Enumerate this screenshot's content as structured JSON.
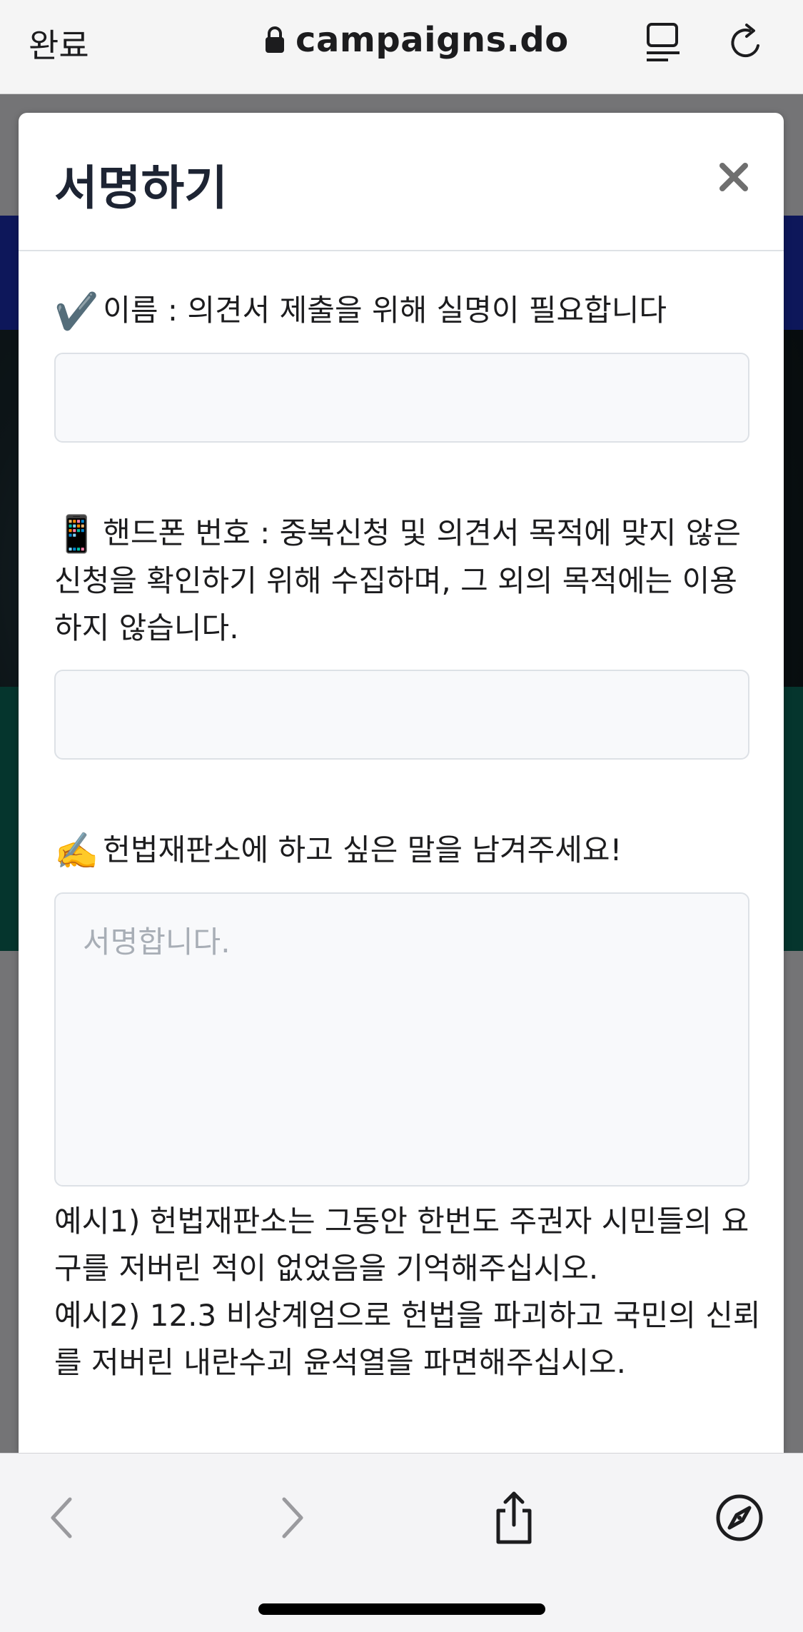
{
  "browser": {
    "done_label": "완료",
    "url": "campaigns.do",
    "icons": [
      "lock-icon",
      "reader-mode-icon",
      "reload-icon"
    ]
  },
  "modal": {
    "title": "서명하기",
    "close_glyph": "×",
    "fields": [
      {
        "emoji": "✔️",
        "label": "이름 : 의견서 제출을 위해 실명이 필요합니다",
        "value": ""
      },
      {
        "emoji": "📱",
        "label": "핸드폰 번호 : 중복신청 및 의견서 목적에 맞지 않은 신청을 확인하기 위해 수집하며, 그 외의 목적에는 이용하지 않습니다.",
        "value": ""
      },
      {
        "emoji": "✍️",
        "label": "헌법재판소에 하고 싶은 말을 남겨주세요!",
        "placeholder": "서명합니다."
      }
    ],
    "examples": [
      "예시1) 헌법재판소는 그동안 한번도 주권자 시민들의 요구를 저버린 적이 없었음을 기억해주십시오.",
      "예시2) 12.3 비상계엄으로 헌법을 파괴하고 국민의 신뢰를 저버린 내란수괴 윤석열을 파면해주십시오."
    ]
  },
  "toolbar": {
    "icons": [
      "back-arrow-icon",
      "forward-arrow-icon",
      "share-icon",
      "compass-icon"
    ]
  },
  "colors": {
    "title": "#1d2433",
    "input_bg": "#f8f9fb",
    "input_border": "#dde1e6",
    "placeholder": "#a8aeb6"
  }
}
